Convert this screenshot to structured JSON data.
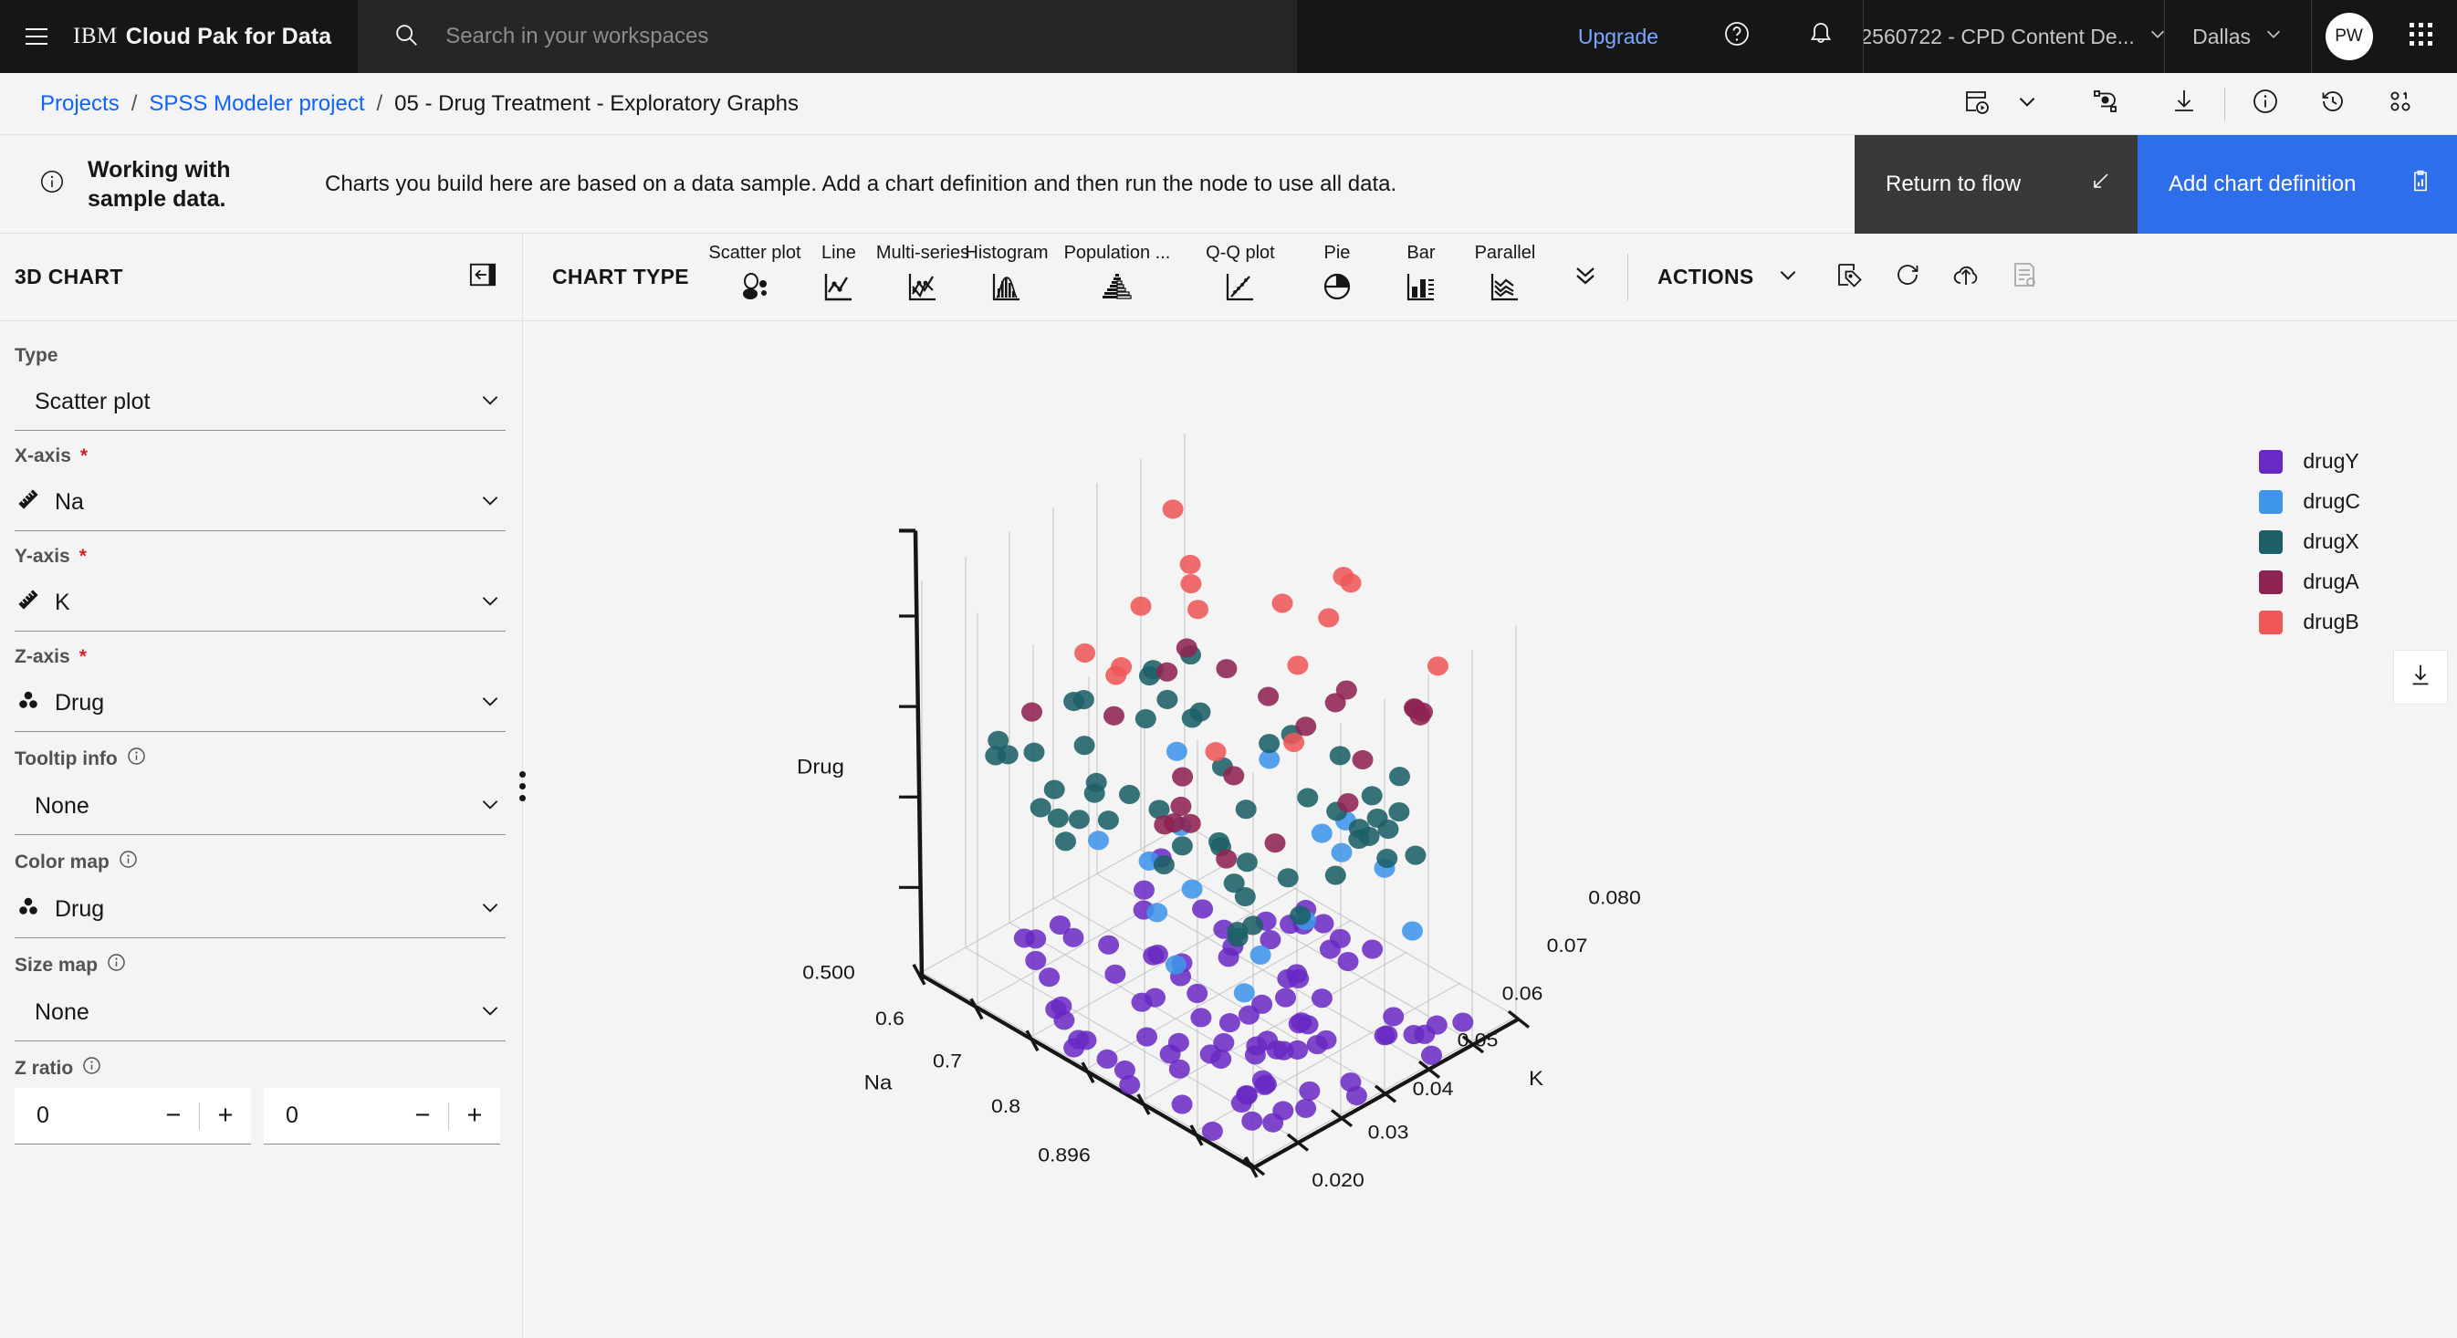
{
  "header": {
    "brand_ibm": "IBM",
    "brand_rest": "Cloud Pak for Data",
    "search_placeholder": "Search in your workspaces",
    "search_value": "",
    "upgrade": "Upgrade",
    "account": "2560722 - CPD Content De...",
    "region": "Dallas",
    "avatar_initials": "PW"
  },
  "breadcrumb": {
    "projects": "Projects",
    "project": "SPSS Modeler project",
    "current": "05 - Drug Treatment - Exploratory Graphs",
    "sep": "/"
  },
  "banner": {
    "title": "Working with sample data.",
    "text": "Charts you build here are based on a data sample. Add a chart definition and then run the node to use all data.",
    "return_to_flow": "Return to flow",
    "add_chart_definition": "Add chart definition"
  },
  "sidebar": {
    "title": "3D CHART",
    "fields": [
      {
        "label": "Type",
        "required": false,
        "value": "Scatter plot",
        "icon": "none",
        "info": false
      },
      {
        "label": "X-axis",
        "required": true,
        "value": "Na",
        "icon": "ruler",
        "info": false
      },
      {
        "label": "Y-axis",
        "required": true,
        "value": "K",
        "icon": "ruler",
        "info": false
      },
      {
        "label": "Z-axis",
        "required": true,
        "value": "Drug",
        "icon": "nominal",
        "info": false
      },
      {
        "label": "Tooltip info",
        "required": false,
        "value": "None",
        "icon": "none",
        "info": true
      },
      {
        "label": "Color map",
        "required": false,
        "value": "Drug",
        "icon": "nominal",
        "info": true
      },
      {
        "label": "Size map",
        "required": false,
        "value": "None",
        "icon": "none",
        "info": true
      }
    ],
    "z_ratio": {
      "label": "Z ratio",
      "info": true,
      "value_a": "0",
      "value_b": "0",
      "minus": "−",
      "plus": "+"
    }
  },
  "chart_type_bar": {
    "label": "CHART TYPE",
    "items": [
      {
        "label": "Scatter plot",
        "icon": "scatter-plot-icon",
        "selected": true
      },
      {
        "label": "Line",
        "icon": "line-chart-icon",
        "selected": false
      },
      {
        "label": "Multi-series",
        "icon": "multi-series-icon",
        "selected": false
      },
      {
        "label": "Histogram",
        "icon": "histogram-icon",
        "selected": false
      },
      {
        "label": "Population ...",
        "icon": "population-pyramid-icon",
        "selected": false
      },
      {
        "label": "Q-Q plot",
        "icon": "qq-plot-icon",
        "selected": false
      },
      {
        "label": "Pie",
        "icon": "pie-chart-icon",
        "selected": false
      },
      {
        "label": "Bar",
        "icon": "bar-chart-icon",
        "selected": false
      },
      {
        "label": "Parallel",
        "icon": "parallel-icon",
        "selected": false
      }
    ],
    "actions_label": "ACTIONS"
  },
  "chart_data": {
    "type": "scatter",
    "title": "",
    "xlabel": "Na",
    "ylabel": "K",
    "zlabel": "Drug",
    "x_ticks": [
      "0.500",
      "0.6",
      "0.7",
      "0.8",
      "0.896"
    ],
    "y_ticks": [
      "0.020",
      "0.03",
      "0.04",
      "0.05",
      "0.06",
      "0.07",
      "0.080"
    ],
    "xlim": [
      0.5,
      0.896
    ],
    "ylim": [
      0.02,
      0.08
    ],
    "grid": true,
    "legend_position": "right",
    "series": [
      {
        "name": "drugY",
        "color": "#6929c4",
        "level": 0,
        "count": 91
      },
      {
        "name": "drugC",
        "color": "#3f95ea",
        "level": 1,
        "count": 16
      },
      {
        "name": "drugX",
        "color": "#1d6068",
        "level": 2,
        "count": 54
      },
      {
        "name": "drugA",
        "color": "#8e2352",
        "level": 3,
        "count": 23
      },
      {
        "name": "drugB",
        "color": "#ee5859",
        "level": 4,
        "count": 16
      }
    ]
  },
  "legend": {
    "items": [
      {
        "label": "drugY",
        "color": "#6929c4"
      },
      {
        "label": "drugC",
        "color": "#3f95ea"
      },
      {
        "label": "drugX",
        "color": "#1d6068"
      },
      {
        "label": "drugA",
        "color": "#8e2352"
      },
      {
        "label": "drugB",
        "color": "#ee5859"
      }
    ]
  },
  "colors": {
    "accent_blue": "#0f62fe",
    "button_blue": "#2f6eeb",
    "dark": "#161616",
    "page_bg": "#f4f4f4",
    "required_red": "#da1e28"
  }
}
